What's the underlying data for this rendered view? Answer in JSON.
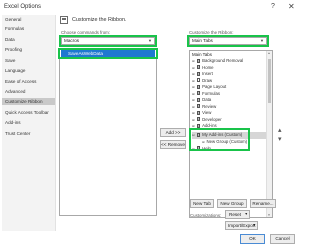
{
  "dialog": {
    "title": "Excel Options",
    "help": "?",
    "close": "✕"
  },
  "sidebar": {
    "items": [
      {
        "label": "General"
      },
      {
        "label": "Formulas"
      },
      {
        "label": "Data"
      },
      {
        "label": "Proofing"
      },
      {
        "label": "Save"
      },
      {
        "label": "Language"
      },
      {
        "label": "Ease of Access"
      },
      {
        "label": "Advanced"
      },
      {
        "label": "Customize Ribbon",
        "selected": true
      },
      {
        "label": "Quick Access Toolbar"
      },
      {
        "label": "Add-ins"
      },
      {
        "label": "Trust Center"
      }
    ]
  },
  "main": {
    "title": "Customize the Ribbon.",
    "left": {
      "label": "Choose commands from:",
      "combo_value": "Macros",
      "list_items": [
        "SaveAsWebData"
      ]
    },
    "right": {
      "label": "Customize the Ribbon:",
      "combo_value": "Main Tabs",
      "tree_header": "Main Tabs",
      "tree_items": [
        {
          "label": "Background Removal",
          "checked": true,
          "expanded": false
        },
        {
          "label": "Home",
          "checked": true,
          "expanded": false
        },
        {
          "label": "Insert",
          "checked": true,
          "expanded": false
        },
        {
          "label": "Draw",
          "checked": false,
          "expanded": false
        },
        {
          "label": "Page Layout",
          "checked": true,
          "expanded": false
        },
        {
          "label": "Formulas",
          "checked": true,
          "expanded": false
        },
        {
          "label": "Data",
          "checked": true,
          "expanded": false
        },
        {
          "label": "Review",
          "checked": true,
          "expanded": false
        },
        {
          "label": "View",
          "checked": true,
          "expanded": false
        },
        {
          "label": "Developer",
          "checked": true,
          "expanded": false
        },
        {
          "label": "Add-ins",
          "checked": true,
          "expanded": false
        },
        {
          "label": "My Add-ins (Custom)",
          "checked": true,
          "expanded": true
        },
        {
          "label": "New Group (Custom)",
          "checked": false,
          "expanded": false,
          "child": true
        },
        {
          "label": "Help",
          "checked": true,
          "expanded": false
        }
      ]
    },
    "add_button": "Add >>",
    "remove_button": "<< Remove",
    "new_tab_button": "New Tab",
    "new_group_button": "New Group",
    "rename_button": "Rename...",
    "customizations_label": "Customizations:",
    "reset_button": "Reset",
    "import_export_button": "Import/Export"
  },
  "footer": {
    "ok": "OK",
    "cancel": "Cancel"
  },
  "colors": {
    "highlight": "#19c34a",
    "selection": "#1f78d1"
  }
}
